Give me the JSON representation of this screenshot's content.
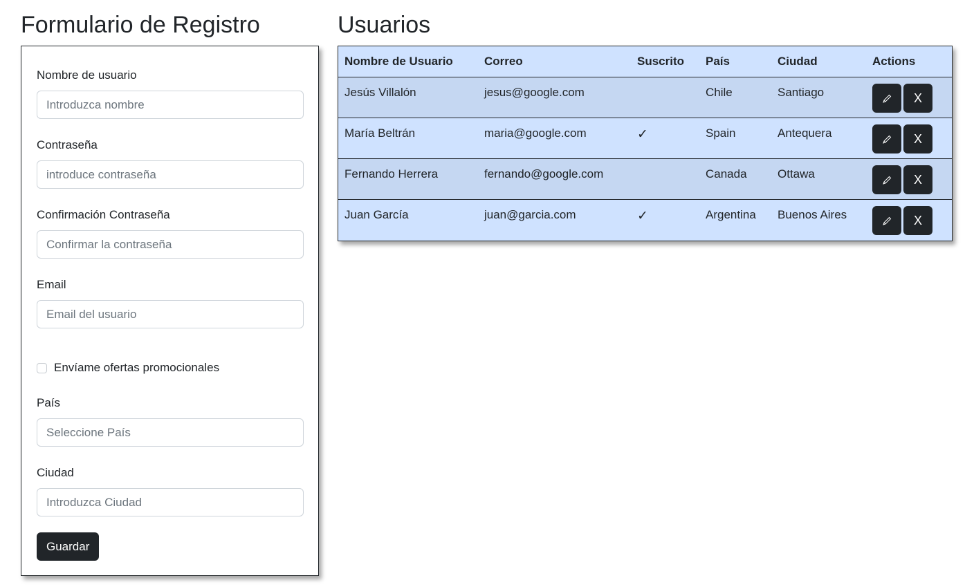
{
  "form": {
    "title": "Formulario de Registro",
    "fields": [
      {
        "label": "Nombre de usuario",
        "placeholder": "Introduzca nombre"
      },
      {
        "label": "Contraseña",
        "placeholder": "introduce contraseña"
      },
      {
        "label": "Confirmación Contraseña",
        "placeholder": "Confirmar la contraseña"
      },
      {
        "label": "Email",
        "placeholder": "Email del usuario"
      },
      {
        "label": "País",
        "placeholder": "Seleccione País"
      },
      {
        "label": "Ciudad",
        "placeholder": "Introduzca Ciudad"
      }
    ],
    "checkbox_label": "Envíame ofertas promocionales",
    "save_label": "Guardar"
  },
  "users": {
    "title": "Usuarios",
    "columns": [
      "Nombre de Usuario",
      "Correo",
      "Suscrito",
      "País",
      "Ciudad",
      "Actions"
    ],
    "rows": [
      {
        "name": "Jesús Villalón",
        "email": "jesus@google.com",
        "subscribed": "",
        "country": "Chile",
        "city": "Santiago"
      },
      {
        "name": "María Beltrán",
        "email": "maria@google.com",
        "subscribed": "✓",
        "country": "Spain",
        "city": "Antequera"
      },
      {
        "name": "Fernando Herrera",
        "email": "fernando@google.com",
        "subscribed": "",
        "country": "Canada",
        "city": "Ottawa"
      },
      {
        "name": "Juan García",
        "email": "juan@garcia.com",
        "subscribed": "✓",
        "country": "Argentina",
        "city": "Buenos Aires"
      }
    ],
    "delete_glyph": "X"
  },
  "colors": {
    "table_bg": "#cfe2ff",
    "table_row_alt": "#c5d7f2",
    "dark": "#212529"
  }
}
